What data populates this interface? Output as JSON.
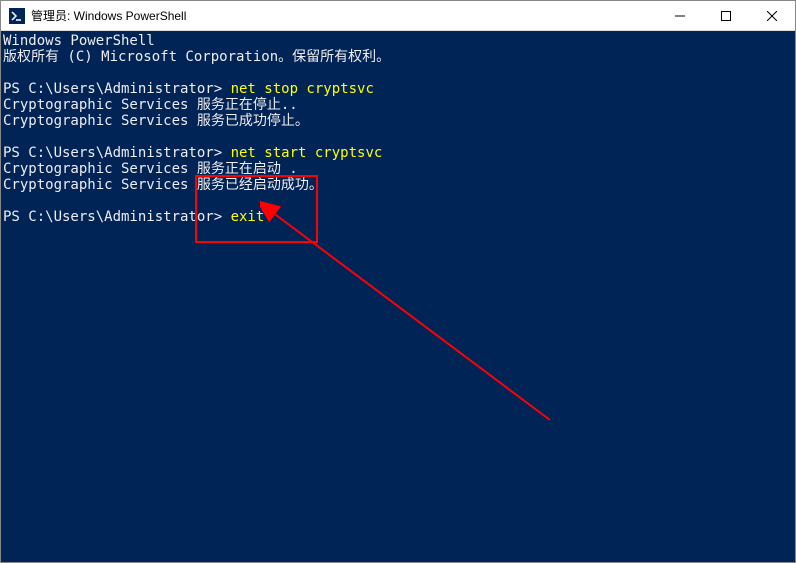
{
  "window": {
    "title": "管理员: Windows PowerShell"
  },
  "terminal": {
    "line1": "Windows PowerShell",
    "line2": "版权所有 (C) Microsoft Corporation。保留所有权利。",
    "prompt1": "PS C:\\Users\\Administrator> ",
    "cmd1": "net stop cryptsvc",
    "out1a": "Cryptographic Services 服务正在停止..",
    "out1b": "Cryptographic Services 服务已成功停止。",
    "prompt2": "PS C:\\Users\\Administrator> ",
    "cmd2": "net start cryptsvc",
    "out2a": "Cryptographic Services 服务正在启动 .",
    "out2b": "Cryptographic Services 服务已经启动成功。",
    "prompt3": "PS C:\\Users\\Administrator> ",
    "cmd3": "exit"
  },
  "controls": {
    "minimize": "—",
    "maximize": "□",
    "close": "✕"
  }
}
